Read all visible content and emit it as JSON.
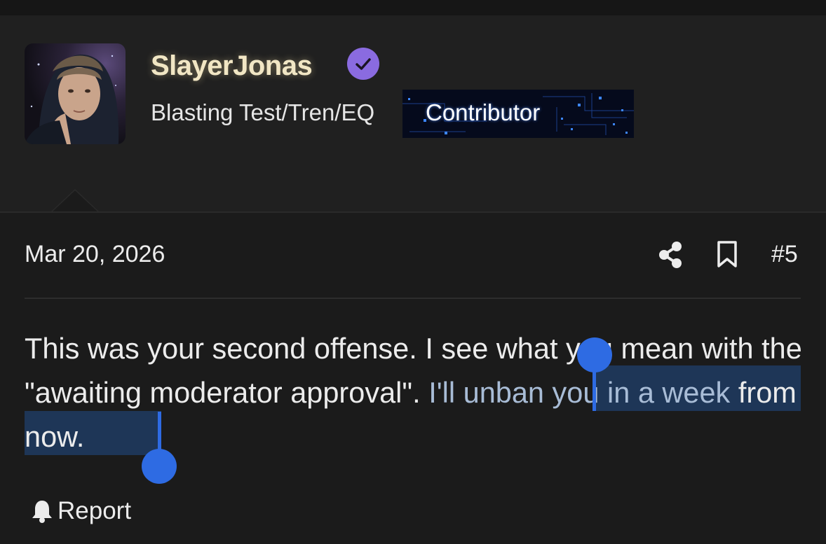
{
  "author": {
    "username": "SlayerJonas",
    "verified_icon": "check-circle-icon",
    "user_title": "Blasting Test/Tren/EQ",
    "badge": "Contributor",
    "colors": {
      "username": "#f1e6c4",
      "verified": "#8a6be0",
      "badge_bg": "#050a1c"
    }
  },
  "post": {
    "date": "Mar 20, 2026",
    "number": "#5",
    "actions": {
      "share_icon": "share-icon",
      "bookmark_icon": "bookmark-icon"
    },
    "message": {
      "before_selection": "This was your second offense. I see what you mean with the \"awaiting moderator approval\". ",
      "selected": "I'll unban you in a week",
      "after_selection": " from now."
    },
    "report_label": "Report",
    "report_icon": "bell-icon"
  },
  "selection": {
    "color": "#2e6be3",
    "highlight": "#1e3657"
  }
}
